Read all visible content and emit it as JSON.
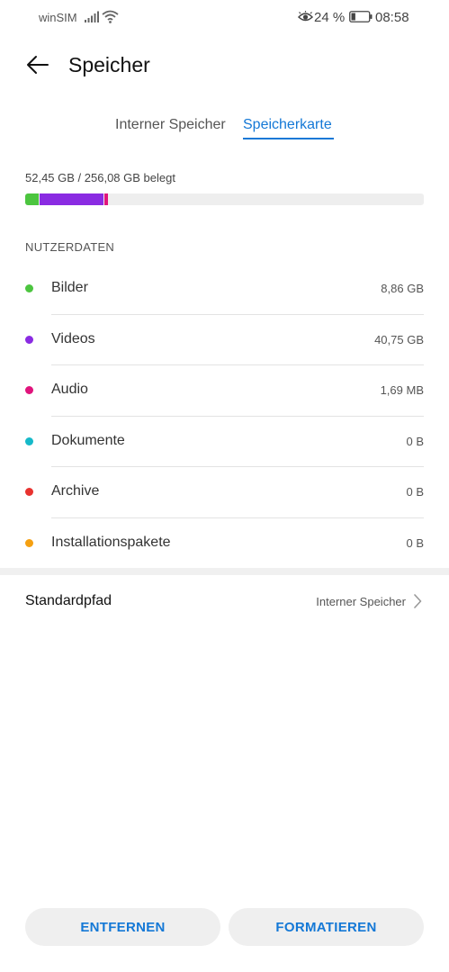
{
  "status_bar": {
    "carrier": "winSIM",
    "battery_percent": "24 %",
    "battery_level": 0.24,
    "time": "08:58",
    "icons": [
      "signal-icon",
      "wifi-icon",
      "eye-comfort-icon",
      "battery-icon"
    ]
  },
  "app_bar": {
    "title": "Speicher",
    "back_icon": "back-arrow-icon"
  },
  "tabs": [
    {
      "label": "Interner Speicher",
      "selected": false
    },
    {
      "label": "Speicherkarte",
      "selected": true
    }
  ],
  "accent_color": "#1478d6",
  "storage": {
    "usage_text": "52,45 GB / 256,08 GB belegt",
    "used_gb": 52.45,
    "total_gb": 256.08
  },
  "section": {
    "header": "NUTZERDATEN"
  },
  "categories": [
    {
      "name": "Bilder",
      "size": "8,86 GB",
      "size_gb": 8.86,
      "color": "#4cc53f"
    },
    {
      "name": "Videos",
      "size": "40,75 GB",
      "size_gb": 40.75,
      "color": "#8a2be2"
    },
    {
      "name": "Audio",
      "size": "1,69 MB",
      "size_gb": 0.00169,
      "color": "#e0147c"
    },
    {
      "name": "Dokumente",
      "size": "0 B",
      "size_gb": 0,
      "color": "#16b9c9"
    },
    {
      "name": "Archive",
      "size": "0 B",
      "size_gb": 0,
      "color": "#e8322f"
    },
    {
      "name": "Installationspakete",
      "size": "0 B",
      "size_gb": 0,
      "color": "#f5a011"
    }
  ],
  "default_path": {
    "label": "Standardpfad",
    "value": "Interner Speicher",
    "icon": "chevron-right-icon"
  },
  "buttons": {
    "remove": "ENTFERNEN",
    "format": "FORMATIEREN"
  }
}
